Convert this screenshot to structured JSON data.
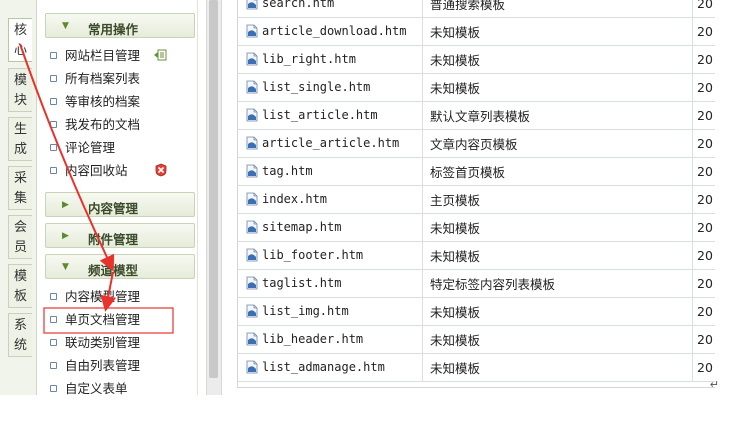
{
  "tabs": [
    "核心",
    "模块",
    "生成",
    "采集",
    "会员",
    "模板",
    "系统"
  ],
  "menu": {
    "group_common": "常用操作",
    "common_items": [
      "网站栏目管理",
      "所有档案列表",
      "等审核的档案",
      "我发布的文档",
      "评论管理",
      "内容回收站"
    ],
    "group_content": "内容管理",
    "group_attach": "附件管理",
    "group_channel": "频道模型",
    "channel_items": [
      "内容模型管理",
      "单页文档管理",
      "联动类别管理",
      "自由列表管理",
      "自定义表单"
    ]
  },
  "files": [
    {
      "name": "search.htm",
      "desc": "普通搜索模板",
      "date": "20"
    },
    {
      "name": "article_download.htm",
      "desc": "未知模板",
      "date": "20"
    },
    {
      "name": "lib_right.htm",
      "desc": "未知模板",
      "date": "20"
    },
    {
      "name": "list_single.htm",
      "desc": "未知模板",
      "date": "20"
    },
    {
      "name": "list_article.htm",
      "desc": "默认文章列表模板",
      "date": "20"
    },
    {
      "name": "article_article.htm",
      "desc": "文章内容页模板",
      "date": "20"
    },
    {
      "name": "tag.htm",
      "desc": "标签首页模板",
      "date": "20"
    },
    {
      "name": "index.htm",
      "desc": "主页模板",
      "date": "20"
    },
    {
      "name": "sitemap.htm",
      "desc": "未知模板",
      "date": "20"
    },
    {
      "name": "lib_footer.htm",
      "desc": "未知模板",
      "date": "20"
    },
    {
      "name": "taglist.htm",
      "desc": "特定标签内容列表模板",
      "date": "20"
    },
    {
      "name": "list_img.htm",
      "desc": "未知模板",
      "date": "20"
    },
    {
      "name": "lib_header.htm",
      "desc": "未知模板",
      "date": "20"
    },
    {
      "name": "list_admanage.htm",
      "desc": "未知模板",
      "date": "20"
    }
  ],
  "colors": {
    "annotation": "#e8332d",
    "menu_bullet": "#6a86a8",
    "group_arrow": "#5d8a2d"
  },
  "icons": {
    "add": "add-column-icon",
    "recycle": "recycle-bin-icon",
    "file": "html-file-icon"
  },
  "corner_mark": "↵"
}
